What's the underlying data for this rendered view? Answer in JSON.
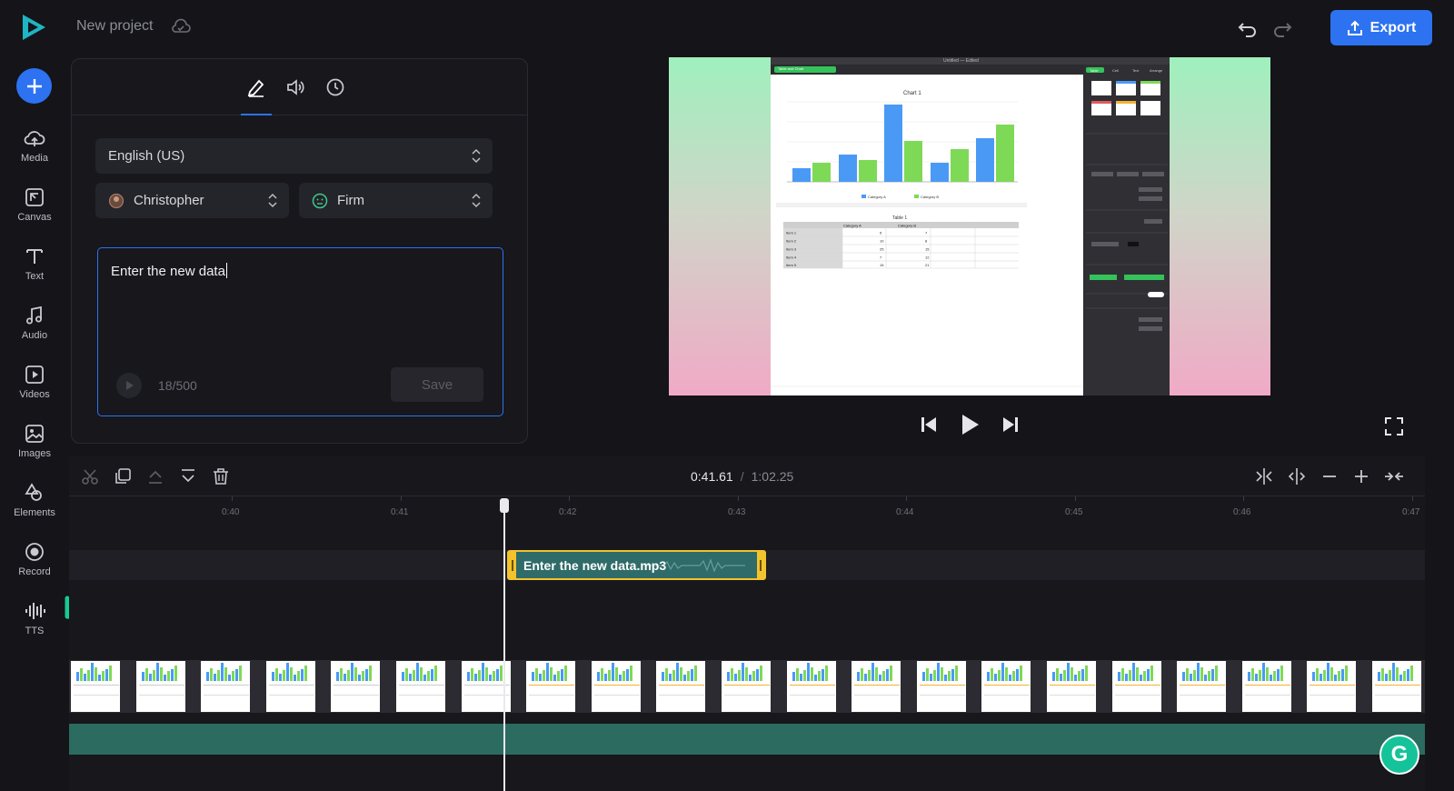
{
  "app": {
    "logo_icon": "play-logo-icon",
    "project_title": "New project",
    "cloud_icon": "cloud-icon"
  },
  "header": {
    "export_label": "Export",
    "undo_icon": "undo-icon",
    "redo_icon": "redo-icon"
  },
  "sidebar": {
    "add_icon": "plus-icon",
    "items": [
      {
        "label": "Media",
        "icon": "cloud-upload-icon"
      },
      {
        "label": "Canvas",
        "icon": "canvas-icon"
      },
      {
        "label": "Text",
        "icon": "text-icon"
      },
      {
        "label": "Audio",
        "icon": "music-note-icon"
      },
      {
        "label": "Videos",
        "icon": "video-icon"
      },
      {
        "label": "Images",
        "icon": "image-icon"
      },
      {
        "label": "Elements",
        "icon": "shapes-icon"
      },
      {
        "label": "Record",
        "icon": "record-icon"
      },
      {
        "label": "TTS",
        "icon": "waveform-icon"
      }
    ]
  },
  "tts_panel": {
    "tabs": [
      "pen-icon",
      "speaker-icon",
      "clock-icon"
    ],
    "language": "English (US)",
    "voice": "Christopher",
    "style": "Firm",
    "text_value": "Enter the new data",
    "char_count": "18/500",
    "save_label": "Save"
  },
  "preview": {
    "screen_title": "Untitled — Edited",
    "tab_label": "Table and Chart",
    "chart_title": "Chart 1",
    "table_title": "Table 1",
    "legend": [
      "Category A",
      "Category B"
    ],
    "table_headers": [
      "Category A",
      "Category B"
    ],
    "table_rows": [
      [
        "Item 1",
        "5",
        "7"
      ],
      [
        "Item 2",
        "10",
        "8"
      ],
      [
        "Item 3",
        "25",
        "15"
      ],
      [
        "Item 4",
        "7",
        "12"
      ],
      [
        "Item 5",
        "15",
        "21"
      ]
    ],
    "inspector_tabs": [
      "Table",
      "Cell",
      "Text",
      "Arrange"
    ]
  },
  "timeline": {
    "time_current": "0:41.61",
    "time_separator": "/",
    "time_total": "1:02.25",
    "ticks": [
      "0:40",
      "0:41",
      "0:42",
      "0:43",
      "0:44",
      "0:45",
      "0:46",
      "0:47"
    ],
    "audio_clip_label": "Enter the new data.mp3"
  },
  "colors": {
    "accent": "#2d72f0",
    "clip_border": "#f2c32c",
    "music_track": "#2c6b60",
    "arrow": "#19c98e"
  }
}
